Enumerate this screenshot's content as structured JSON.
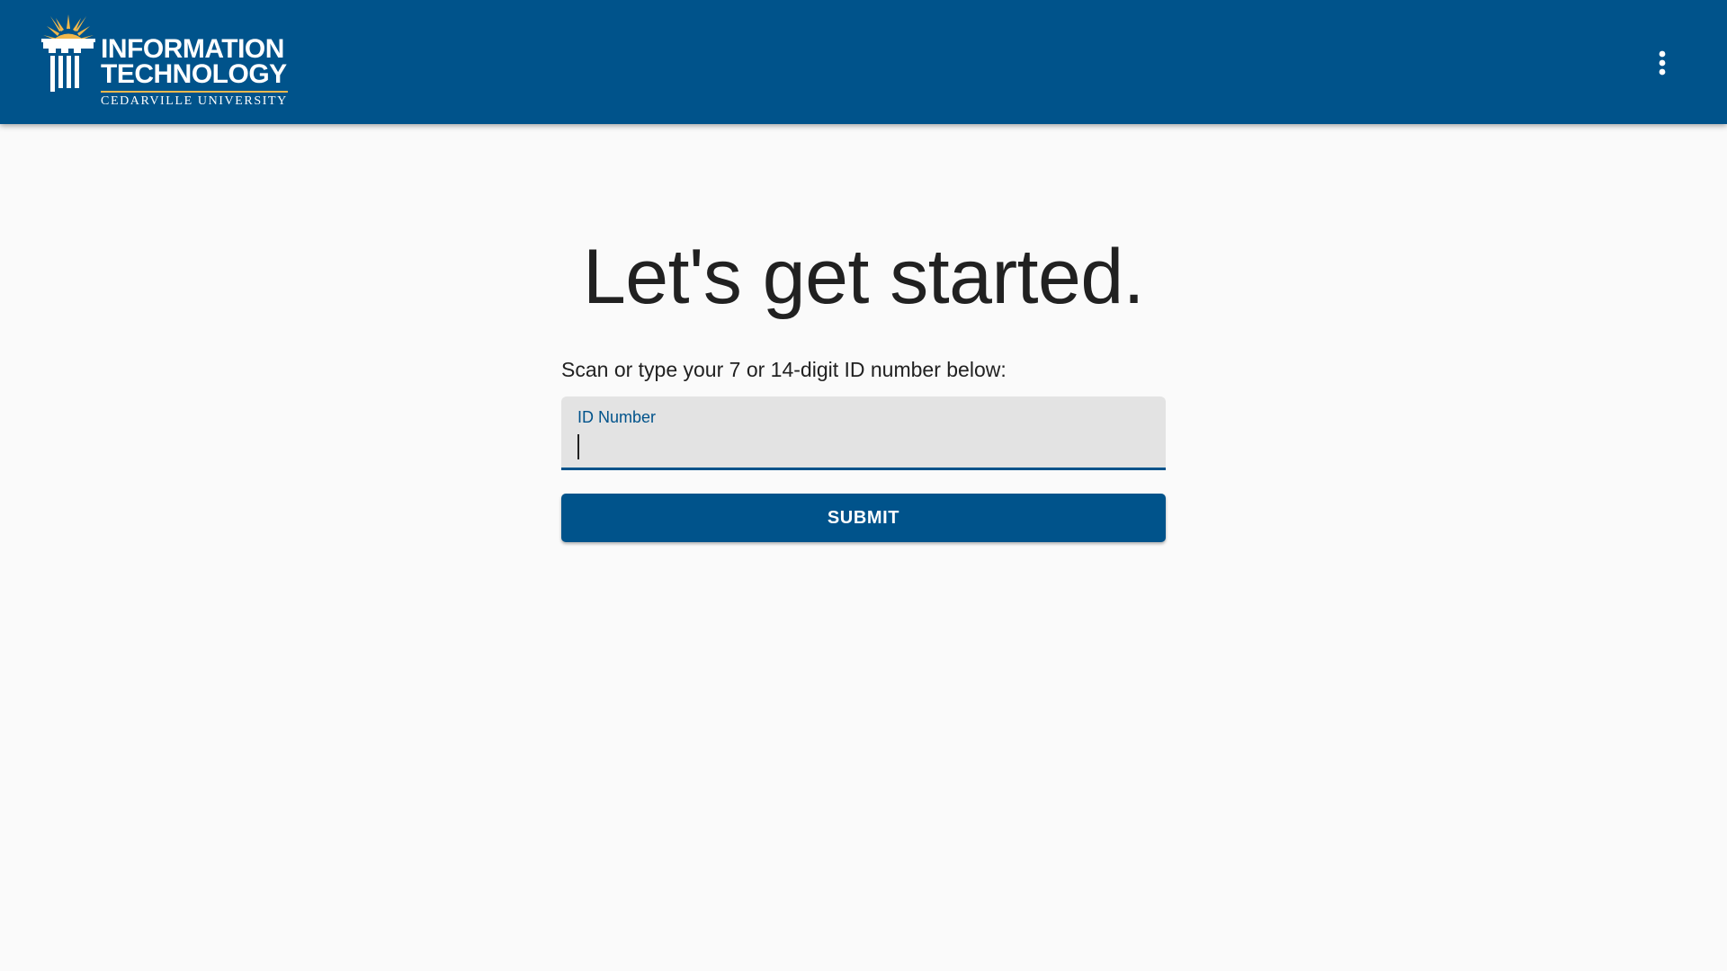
{
  "header": {
    "logo": {
      "line1": "INFORMATION",
      "line2": "TECHNOLOGY",
      "line3": "CEDARVILLE UNIVERSITY"
    },
    "menu_icon": "more-vert-icon"
  },
  "main": {
    "headline": "Let's get started.",
    "instruction": "Scan or type your 7 or 14-digit ID number below:",
    "id_field": {
      "label": "ID Number",
      "value": "",
      "placeholder": ""
    },
    "submit_label": "SUBMIT"
  },
  "colors": {
    "brand_blue": "#00538b",
    "accent_gold": "#f2b84b",
    "page_background": "#fafafa",
    "field_background": "#e3e3e3"
  }
}
